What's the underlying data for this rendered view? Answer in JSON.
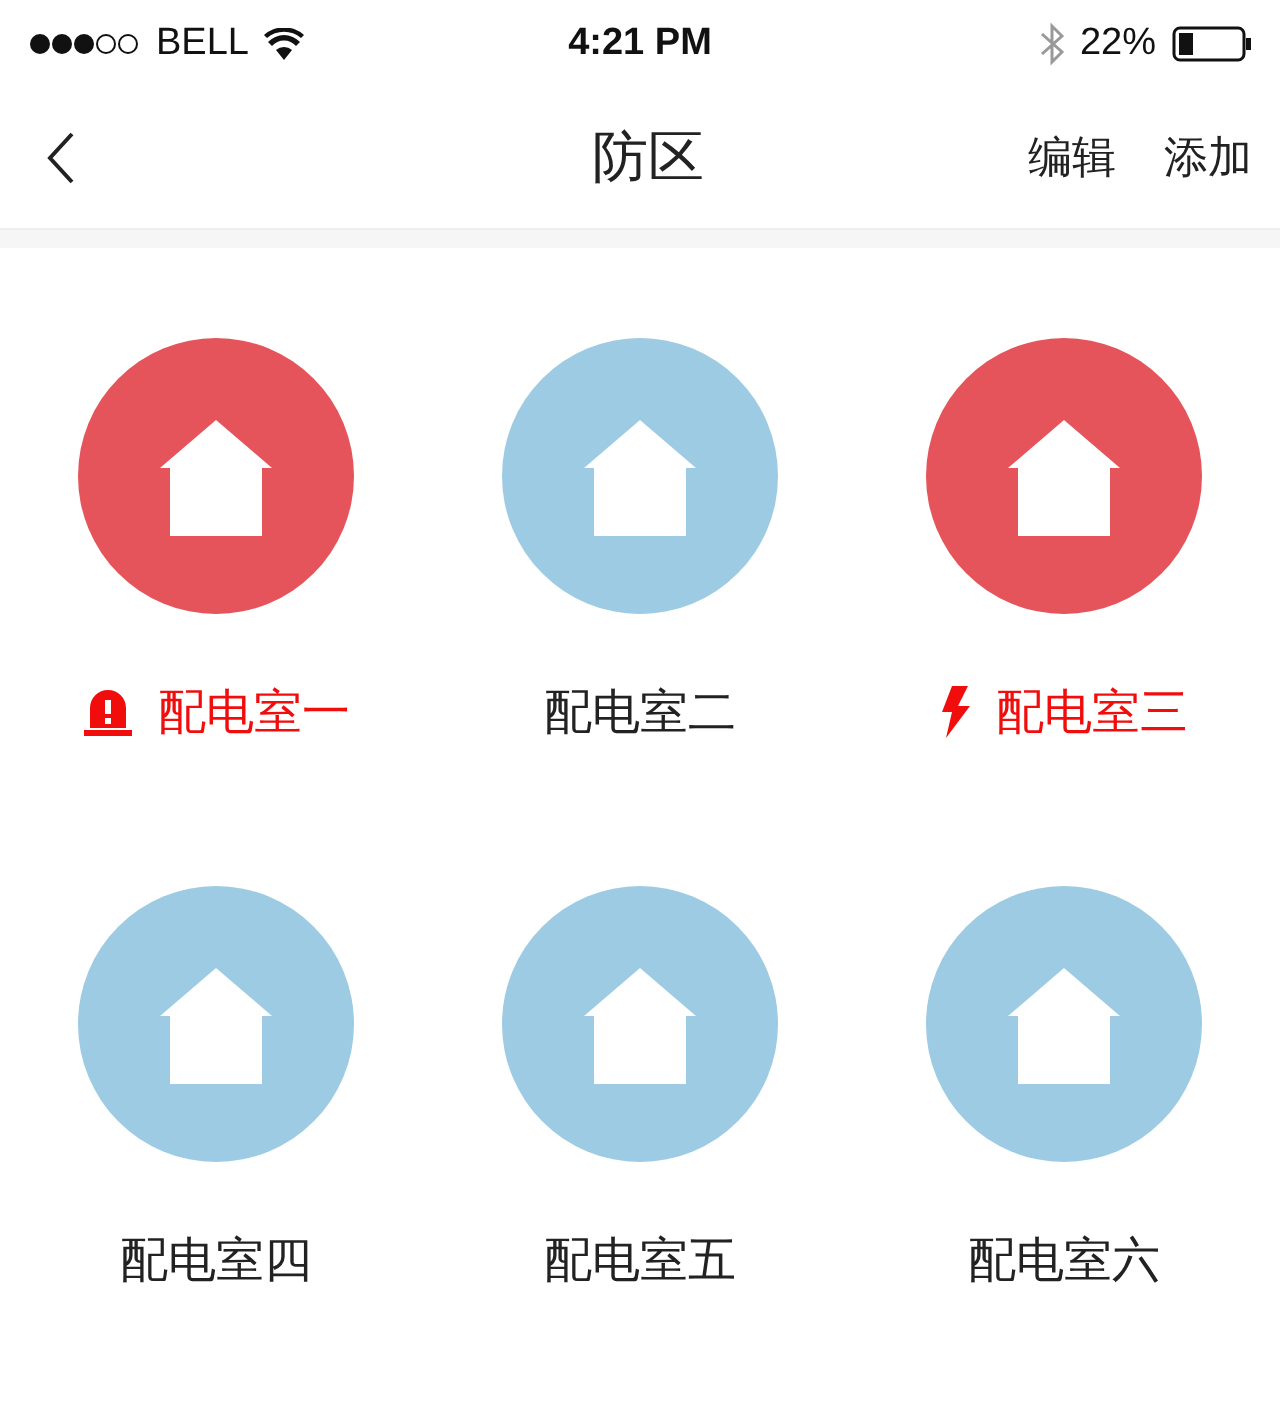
{
  "status_bar": {
    "carrier": "BELL",
    "time": "4:21 PM",
    "battery": "22%"
  },
  "nav": {
    "title": "防区",
    "actions": [
      "编辑",
      "添加"
    ]
  },
  "zones": [
    {
      "name": "配电室一",
      "kind": "alarm"
    },
    {
      "name": "配电室二",
      "kind": "normal"
    },
    {
      "name": "配电室三",
      "kind": "power"
    },
    {
      "name": "配电室四",
      "kind": "normal"
    },
    {
      "name": "配电室五",
      "kind": "normal"
    },
    {
      "name": "配电室六",
      "kind": "normal"
    }
  ]
}
